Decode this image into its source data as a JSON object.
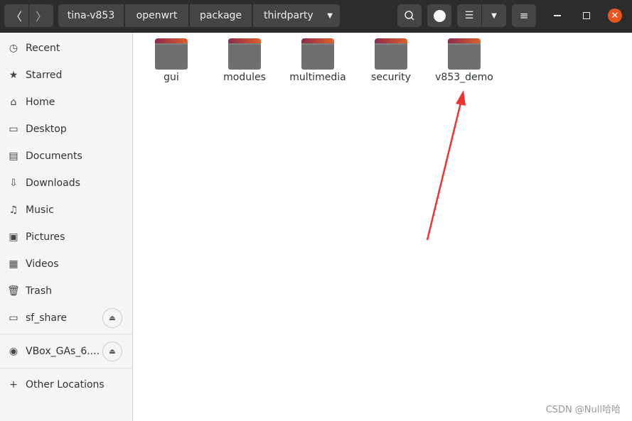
{
  "header": {
    "back_icon": "chevron-left-icon",
    "forward_icon": "chevron-right-icon",
    "breadcrumb": [
      "tina-v853",
      "openwrt",
      "package",
      "thirdparty"
    ],
    "search_icon": "search-icon",
    "window_controls": [
      "minimize-icon",
      "maximize-icon",
      "close-icon"
    ],
    "close_color": "#e95420"
  },
  "sidebar": {
    "items": [
      {
        "label": "Recent",
        "icon": "clock-icon"
      },
      {
        "label": "Starred",
        "icon": "star-icon"
      },
      {
        "label": "Home",
        "icon": "home-icon"
      },
      {
        "label": "Desktop",
        "icon": "desktop-icon"
      },
      {
        "label": "Documents",
        "icon": "document-icon"
      },
      {
        "label": "Downloads",
        "icon": "download-icon"
      },
      {
        "label": "Music",
        "icon": "music-icon"
      },
      {
        "label": "Pictures",
        "icon": "picture-icon"
      },
      {
        "label": "Videos",
        "icon": "video-icon"
      },
      {
        "label": "Trash",
        "icon": "trash-icon"
      },
      {
        "label": "sf_share",
        "icon": "drive-icon"
      },
      {
        "label": "VBox_GAs_6....",
        "icon": "disc-icon"
      },
      {
        "label": "Other Locations",
        "icon": "plus-icon"
      }
    ]
  },
  "folders": [
    "gui",
    "modules",
    "multimedia",
    "security",
    "v853_demo"
  ],
  "annotation_color": "#ee3333",
  "watermark": "CSDN @Null哈哈"
}
